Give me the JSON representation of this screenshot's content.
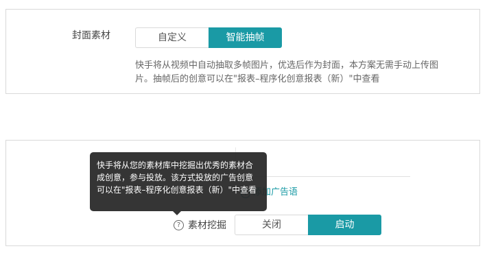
{
  "cover": {
    "label": "封面素材",
    "options": [
      "自定义",
      "智能抽帧"
    ],
    "selected": "智能抽帧",
    "description": "快手将从视频中自动抽取多帧图片，优选后作为封面，本方案无需手动上传图片。抽帧后的创意可以在\"报表–程序化创意报表（新）\"中查看"
  },
  "adcopy": {
    "add_label": "添加广告语",
    "add_icon": "plus-circle-icon"
  },
  "mining": {
    "label": "素材挖掘",
    "help_icon": "question-circle-icon",
    "options": [
      "关闭",
      "启动"
    ],
    "selected": "启动",
    "tooltip": "快手将从您的素材库中挖掘出优秀的素材合成创意，参与投放。该方式投放的广告创意可以在\"报表–程序化创意报表（新）\"中查看"
  },
  "colors": {
    "accent": "#1a9aa5",
    "tooltip_bg": "#262626"
  }
}
